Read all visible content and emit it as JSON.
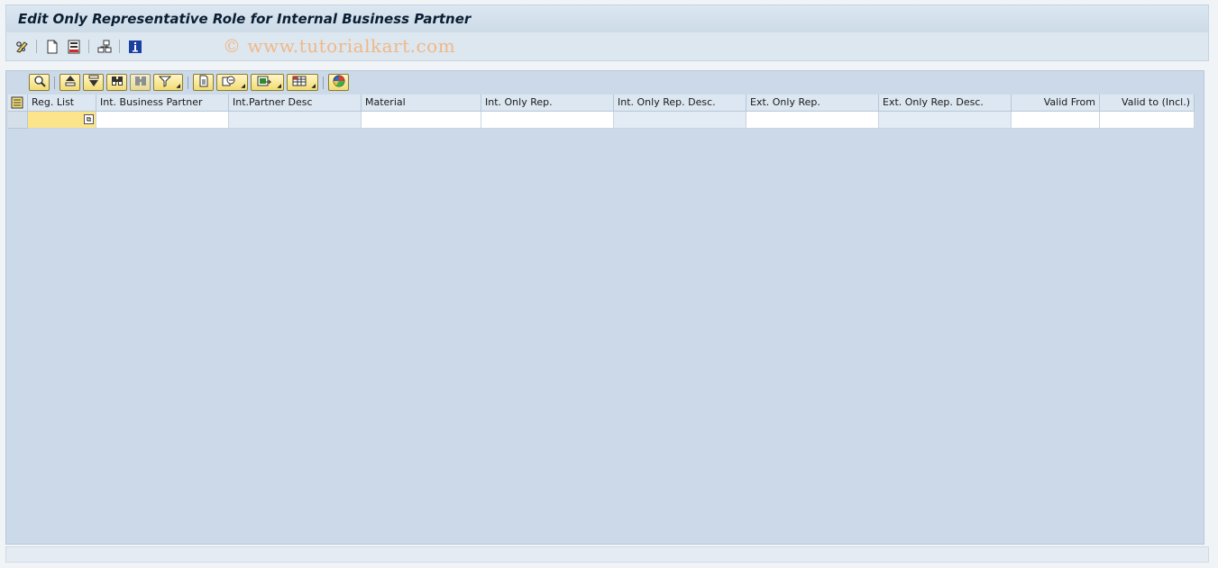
{
  "window": {
    "title": "Edit Only Representative Role for Internal Business Partner"
  },
  "app_toolbar": {
    "icons": [
      "edit-glasses-icon",
      "new-document-icon",
      "save-layout-icon",
      "where-used-icon",
      "info-icon"
    ],
    "watermark": "© www.tutorialkart.com"
  },
  "alv_toolbar": {
    "buttons": [
      "details-icon",
      "sort-ascending-icon",
      "sort-descending-icon",
      "find-icon",
      "find-next-icon",
      "filter-icon",
      "print-preview-icon",
      "export-icon",
      "local-file-icon",
      "change-layout-icon",
      "graphic-icon"
    ]
  },
  "grid": {
    "columns": [
      "Reg. List",
      "Int. Business Partner",
      "Int.Partner Desc",
      "Material",
      "Int. Only Rep.",
      "Int. Only Rep. Desc.",
      "Ext. Only Rep.",
      "Ext. Only Rep. Desc.",
      "Valid From",
      "Valid to (Incl.)"
    ],
    "rows": [
      [
        "",
        "",
        "",
        "",
        "",
        "",
        "",
        "",
        "",
        ""
      ]
    ]
  },
  "colors": {
    "panel_bg": "#cbd9e8",
    "header_bg": "#dde7f1",
    "focus_cell": "#fbe48a",
    "button_yellow": "#f2dc74"
  }
}
